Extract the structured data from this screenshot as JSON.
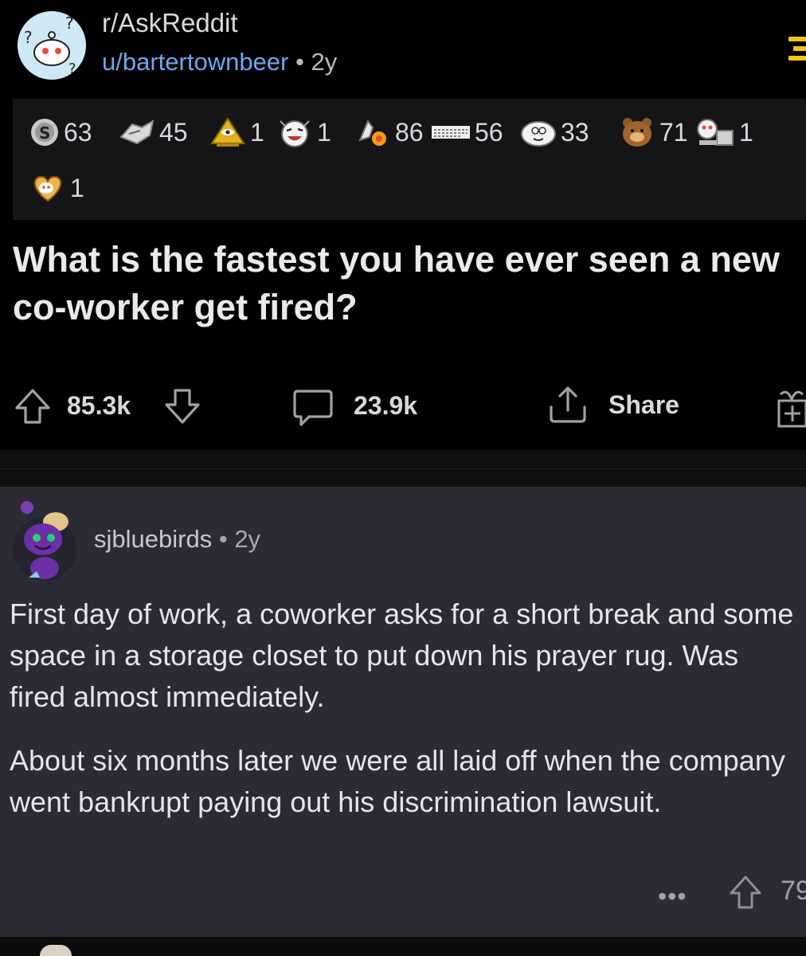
{
  "post": {
    "subreddit": "r/AskReddit",
    "author": "u/bartertownbeer",
    "separator": "•",
    "age": "2y",
    "title": "What is the fastest you have ever seen a new co-worker get fired?",
    "awards": [
      {
        "icon": "silver-coin-award-icon",
        "count": "63"
      },
      {
        "icon": "helpful-hands-award-icon",
        "count": "45"
      },
      {
        "icon": "pyramid-eye-award-icon",
        "count": "1"
      },
      {
        "icon": "laughing-face-award-icon",
        "count": "1"
      },
      {
        "icon": "wholesome-seal-award-icon",
        "count": "86"
      },
      {
        "icon": "text-block-award-icon",
        "count": "56"
      },
      {
        "icon": "bubble-face-award-icon",
        "count": "33"
      },
      {
        "icon": "bear-award-icon",
        "count": "71"
      },
      {
        "icon": "snoo-robot-award-icon",
        "count": "1"
      },
      {
        "icon": "heart-snoo-award-icon",
        "count": "1"
      }
    ],
    "upvotes": "85.3k",
    "comments": "23.9k",
    "share_label": "Share"
  },
  "comment": {
    "author": "sjbluebirds",
    "separator": "•",
    "age": "2y",
    "paragraphs": [
      "First day of work, a coworker asks for a short break and some space in a storage closet to put down his prayer rug.  Was fired almost immediately.",
      "About six months later we were all laid off when the company went bankrupt paying out his discrimination lawsuit."
    ],
    "more_label": "•••",
    "score": "79"
  },
  "colors": {
    "background": "#000000",
    "awards_panel": "#151517",
    "comment_bg": "#2a2b34",
    "username_link": "#6ea6ef",
    "menu_accent": "#f0c419"
  }
}
